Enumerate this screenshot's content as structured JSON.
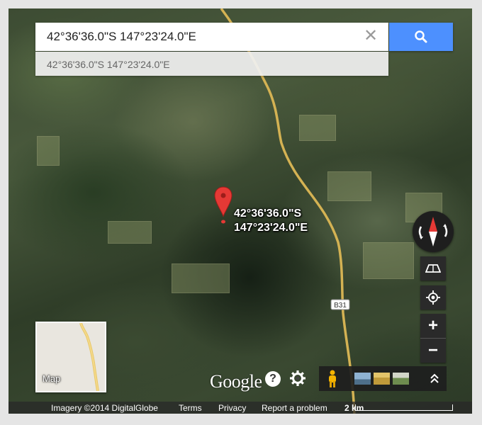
{
  "search": {
    "value": "42°36'36.0\"S 147°23'24.0\"E",
    "clear_icon": "close-icon",
    "search_icon": "search-icon"
  },
  "suggestion": {
    "text": "42°36'36.0\"S 147°23'24.0\"E"
  },
  "marker": {
    "icon": "map-pin-icon",
    "color": "#e53935",
    "label_line1": "42°36'36.0\"S",
    "label_line2": "147°23'24.0\"E"
  },
  "road_shield": "B31",
  "minimap": {
    "label": "Map"
  },
  "logo": "Google",
  "controls": {
    "compass_icon": "compass-icon",
    "tilt_icon": "tilt-icon",
    "locate_icon": "my-location-icon",
    "zoom_in": "+",
    "zoom_out": "−",
    "help_icon": "help-icon",
    "settings_icon": "gear-icon",
    "pegman_icon": "pegman-icon",
    "expand_icon": "chevron-up-double-icon"
  },
  "attribution": {
    "imagery": "Imagery ©2014 DigitalGlobe",
    "terms": "Terms",
    "privacy": "Privacy",
    "report": "Report a problem",
    "scale": "2 km"
  },
  "colors": {
    "accent": "#4d90fe",
    "road": "#d4b253"
  }
}
